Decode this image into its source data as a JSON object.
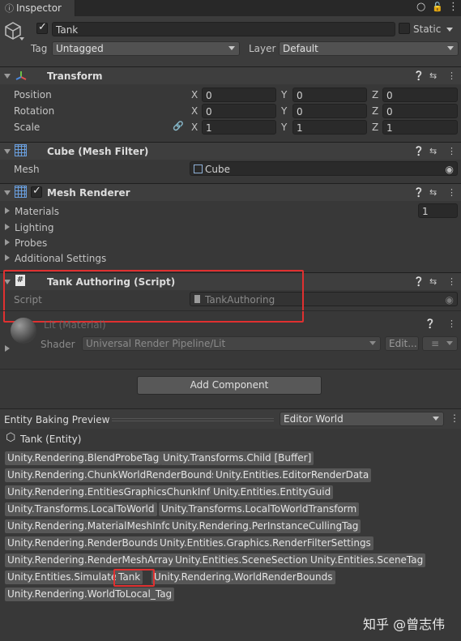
{
  "tab": {
    "label": "Inspector",
    "icons": [
      "info-icon",
      "circle-icon",
      "lock-icon",
      "menu-icon"
    ]
  },
  "gameobject": {
    "name": "Tank",
    "active": true,
    "static_label": "Static",
    "tag_label": "Tag",
    "tag_value": "Untagged",
    "layer_label": "Layer",
    "layer_value": "Default"
  },
  "transform": {
    "title": "Transform",
    "position_label": "Position",
    "rotation_label": "Rotation",
    "scale_label": "Scale",
    "axes": [
      "X",
      "Y",
      "Z"
    ],
    "position": [
      "0",
      "0",
      "0"
    ],
    "rotation": [
      "0",
      "0",
      "0"
    ],
    "scale": [
      "1",
      "1",
      "1"
    ]
  },
  "mesh_filter": {
    "title": "Cube (Mesh Filter)",
    "mesh_label": "Mesh",
    "mesh_value": "Cube"
  },
  "mesh_renderer": {
    "title": "Mesh Renderer",
    "materials_label": "Materials",
    "materials_count": "1",
    "lighting_label": "Lighting",
    "probes_label": "Probes",
    "additional_label": "Additional Settings"
  },
  "tank_authoring": {
    "title": "Tank Authoring (Script)",
    "script_label": "Script",
    "script_value": "TankAuthoring"
  },
  "material": {
    "title": "Lit (Material)",
    "shader_label": "Shader",
    "shader_value": "Universal Render Pipeline/Lit",
    "edit_label": "Edit..."
  },
  "add_component_label": "Add Component",
  "baking": {
    "title": "Entity Baking Preview",
    "world_value": "Editor World",
    "entity_label": "Tank (Entity)",
    "tags": [
      "Unity.Rendering.BlendProbeTag",
      "Unity.Transforms.Child [Buffer]",
      "Unity.Rendering.ChunkWorldRenderBounds",
      "Unity.Entities.EditorRenderData",
      "Unity.Rendering.EntitiesGraphicsChunkInfo",
      "Unity.Entities.EntityGuid",
      "Unity.Transforms.LocalToWorld",
      "Unity.Transforms.LocalToWorldTransform",
      "Unity.Rendering.MaterialMeshInfo",
      "Unity.Rendering.PerInstanceCullingTag",
      "Unity.Rendering.RenderBounds",
      "Unity.Entities.Graphics.RenderFilterSettings",
      "Unity.Rendering.RenderMeshArray",
      "Unity.Entities.SceneSection",
      "Unity.Entities.SceneTag",
      "Unity.Entities.Simulate",
      "Tank",
      "Unity.Rendering.WorldRenderBounds",
      "Unity.Rendering.WorldToLocal_Tag"
    ]
  },
  "watermark": "知乎 @曾志伟",
  "colors": {
    "background": "#383838",
    "highlight_red": "#e03030",
    "tag_bg": "#575757"
  }
}
